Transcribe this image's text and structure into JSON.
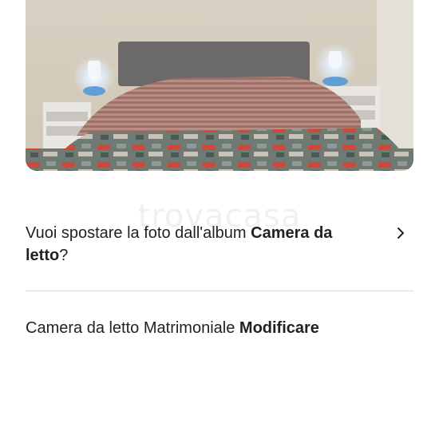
{
  "photo": {
    "subject": "bedroom with double bed, striped blanket, patterned quilt and two bedside lamps"
  },
  "watermark": {
    "text": "trovacasa"
  },
  "move_prompt": {
    "prefix": "Vuoi spostare la foto dall'album ",
    "album_name": "Camera da letto",
    "suffix": "?",
    "chevron_icon": "chevron-right-icon"
  },
  "room": {
    "label": "Camera da letto Matrimoniale",
    "edit_label": "Modificare"
  },
  "colors": {
    "text": "#222222",
    "divider": "#dddddd",
    "background": "#ffffff"
  }
}
